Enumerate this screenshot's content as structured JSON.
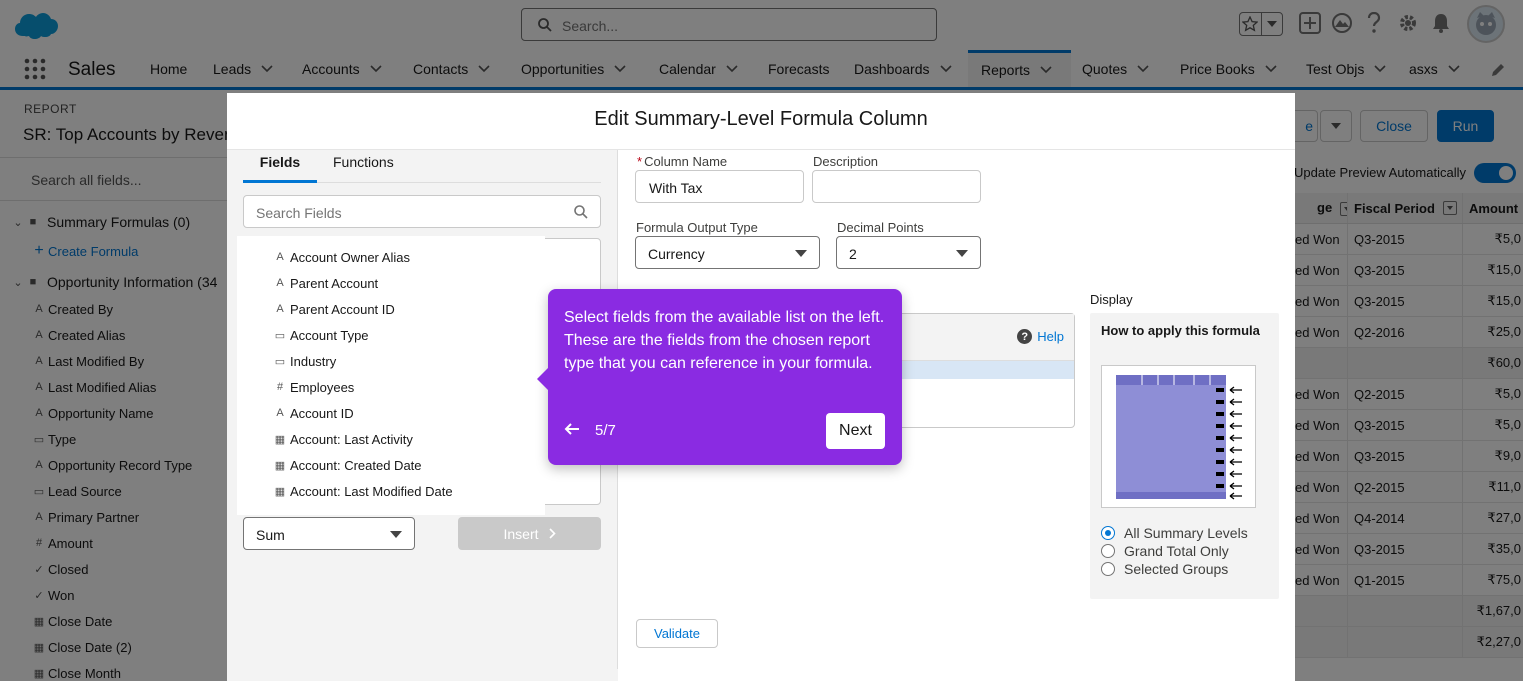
{
  "header": {
    "search_placeholder": "Search...",
    "icons": [
      "salesforce-cloud-logo",
      "search-icon",
      "star-icon",
      "chevron-down-icon",
      "plus-icon",
      "trailhead-icon",
      "question-icon",
      "gear-icon",
      "bell-icon",
      "avatar"
    ]
  },
  "nav": {
    "app_name": "Sales",
    "items": [
      {
        "label": "Home"
      },
      {
        "label": "Leads"
      },
      {
        "label": "Accounts"
      },
      {
        "label": "Contacts"
      },
      {
        "label": "Opportunities"
      },
      {
        "label": "Calendar"
      },
      {
        "label": "Forecasts"
      },
      {
        "label": "Dashboards"
      },
      {
        "label": "Reports"
      },
      {
        "label": "Quotes"
      },
      {
        "label": "Price Books"
      },
      {
        "label": "Test Objs"
      },
      {
        "label": "asxs"
      }
    ],
    "active": "Reports"
  },
  "report": {
    "label": "REPORT",
    "title": "SR: Top Accounts by Reven",
    "buttons": {
      "save_partial": "e",
      "close": "Close",
      "run": "Run"
    },
    "toggle_label": "Update Preview Automatically",
    "left_panel": {
      "search_placeholder": "Search all fields...",
      "summary_group": "Summary Formulas (0)",
      "create_formula": "Create Formula",
      "opp_group": "Opportunity Information (34",
      "fields": [
        {
          "icon": "A",
          "label": "Created By"
        },
        {
          "icon": "A",
          "label": "Created Alias"
        },
        {
          "icon": "A",
          "label": "Last Modified By"
        },
        {
          "icon": "A",
          "label": "Last Modified Alias"
        },
        {
          "icon": "A",
          "label": "Opportunity Name"
        },
        {
          "icon": "▭",
          "label": "Type"
        },
        {
          "icon": "A",
          "label": "Opportunity Record Type"
        },
        {
          "icon": "▭",
          "label": "Lead Source"
        },
        {
          "icon": "A",
          "label": "Primary Partner"
        },
        {
          "icon": "#",
          "label": "Amount"
        },
        {
          "icon": "✓",
          "label": "Closed"
        },
        {
          "icon": "✓",
          "label": "Won"
        },
        {
          "icon": "▦",
          "label": "Close Date"
        },
        {
          "icon": "▦",
          "label": "Close Date (2)"
        },
        {
          "icon": "▦",
          "label": "Close Month"
        }
      ]
    },
    "grid": {
      "headers": [
        "ge",
        "Fiscal Period",
        "Amount"
      ],
      "rows": [
        [
          "ed Won",
          "Q3-2015",
          "₹5,0"
        ],
        [
          "ed Won",
          "Q3-2015",
          "₹15,0"
        ],
        [
          "ed Won",
          "Q3-2015",
          "₹15,0"
        ],
        [
          "ed Won",
          "Q2-2016",
          "₹25,0"
        ],
        [
          "",
          "",
          "₹60,0"
        ],
        [
          "ed Won",
          "Q2-2015",
          "₹5,0"
        ],
        [
          "ed Won",
          "Q3-2015",
          "₹5,0"
        ],
        [
          "ed Won",
          "Q3-2015",
          "₹9,0"
        ],
        [
          "ed Won",
          "Q2-2015",
          "₹11,0"
        ],
        [
          "ed Won",
          "Q4-2014",
          "₹27,0"
        ],
        [
          "ed Won",
          "Q3-2015",
          "₹35,0"
        ],
        [
          "ed Won",
          "Q1-2015",
          "₹75,0"
        ],
        [
          "",
          "",
          "₹1,67,0"
        ],
        [
          "",
          "",
          "₹2,27,0"
        ]
      ]
    }
  },
  "modal": {
    "title": "Edit Summary-Level Formula Column",
    "tabs": [
      "Fields",
      "Functions"
    ],
    "active_tab": "Fields",
    "search_placeholder": "Search Fields",
    "fields": [
      {
        "icon": "A",
        "label": "Account Owner Alias"
      },
      {
        "icon": "A",
        "label": "Parent Account"
      },
      {
        "icon": "A",
        "label": "Parent Account ID"
      },
      {
        "icon": "▭",
        "label": "Account Type"
      },
      {
        "icon": "▭",
        "label": "Industry"
      },
      {
        "icon": "#",
        "label": "Employees"
      },
      {
        "icon": "A",
        "label": "Account ID"
      },
      {
        "icon": "▦",
        "label": "Account: Last Activity"
      },
      {
        "icon": "▦",
        "label": "Account: Created Date"
      },
      {
        "icon": "▦",
        "label": "Account: Last Modified Date"
      }
    ],
    "aggregate": "Sum",
    "insert_label": "Insert",
    "column_name_label": "Column Name",
    "column_name_value": "With Tax",
    "description_label": "Description",
    "description_value": "",
    "output_type_label": "Formula Output Type",
    "output_type_value": "Currency",
    "decimal_label": "Decimal Points",
    "decimal_value": "2",
    "help_label": "Help",
    "display_label": "Display",
    "howto_title": "How to apply this formula",
    "radios": [
      {
        "label": "All Summary Levels",
        "checked": true
      },
      {
        "label": "Grand Total Only",
        "checked": false
      },
      {
        "label": "Selected Groups",
        "checked": false
      }
    ],
    "validate_label": "Validate"
  },
  "coach": {
    "message": "Select fields from the available list on the left. These are the fields from the chosen report type that you can reference in your formula.",
    "step": "5/7",
    "next_label": "Next",
    "color": "#8a2be2"
  }
}
